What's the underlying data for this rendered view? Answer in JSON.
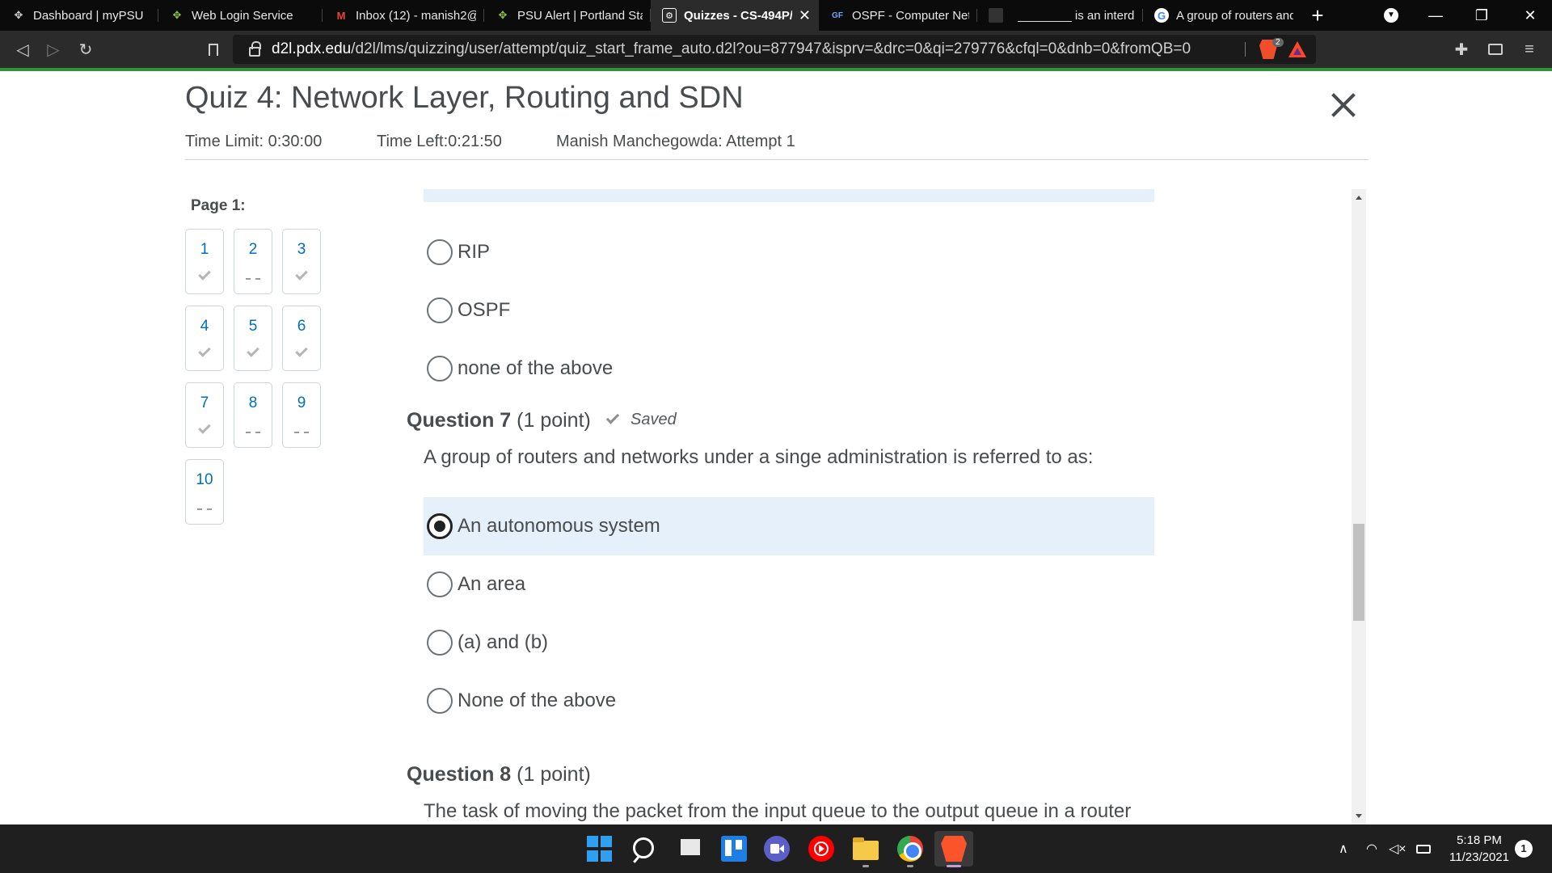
{
  "browser": {
    "tabs": [
      {
        "title": "Dashboard | myPSU",
        "favicon": "psu-logo-icon"
      },
      {
        "title": "Web Login Service",
        "favicon": "psu-logo-icon"
      },
      {
        "title": "Inbox (12) - manish2@",
        "favicon": "gmail-icon"
      },
      {
        "title": "PSU Alert | Portland Sta",
        "favicon": "psu-logo-icon"
      },
      {
        "title": "Quizzes - CS-494P/",
        "favicon": "d2l-icon",
        "active": true
      },
      {
        "title": "OSPF - Computer Netw",
        "favicon": "site-icon"
      },
      {
        "title": "",
        "favicon": "site-icon"
      },
      {
        "title": "________ is an interdo",
        "favicon": ""
      },
      {
        "title": "A group of routers and",
        "favicon": "google-icon"
      }
    ],
    "new_tab_label": "+",
    "url_host": "d2l.pdx.edu",
    "url_path": "/d2l/lms/quizzing/user/attempt/quiz_start_frame_auto.d2l?ou=877947&isprv=&drc=0&qi=279776&cfql=0&dnb=0&fromQB=0",
    "shield_count": "2"
  },
  "quiz": {
    "title": "Quiz 4: Network Layer, Routing and SDN",
    "time_limit": "Time Limit: 0:30:00",
    "time_left": "Time Left:0:21:50",
    "attempt": "Manish Manchegowda: Attempt 1",
    "page_label": "Page 1:",
    "nav": [
      {
        "num": "1",
        "status": "answered"
      },
      {
        "num": "2",
        "status": "unanswered"
      },
      {
        "num": "3",
        "status": "answered"
      },
      {
        "num": "4",
        "status": "answered"
      },
      {
        "num": "5",
        "status": "answered"
      },
      {
        "num": "6",
        "status": "answered"
      },
      {
        "num": "7",
        "status": "answered"
      },
      {
        "num": "8",
        "status": "unanswered"
      },
      {
        "num": "9",
        "status": "unanswered"
      },
      {
        "num": "10",
        "status": "unanswered"
      }
    ],
    "prev_options": [
      "RIP",
      "OSPF",
      "none of the above"
    ],
    "q7": {
      "label": "Question 7",
      "points": "(1 point)",
      "saved": "Saved",
      "text": "A group of routers and networks under a singe administration is referred to as:",
      "options": [
        "An autonomous system",
        "An area",
        "(a) and (b)",
        "None of the above"
      ],
      "selected_index": 0
    },
    "q8": {
      "label": "Question 8",
      "points": "(1 point)",
      "text": "The task of moving the packet from the input queue to the output queue in a router"
    }
  },
  "taskbar": {
    "time": "5:18 PM",
    "date": "11/23/2021",
    "notification_count": "1"
  }
}
